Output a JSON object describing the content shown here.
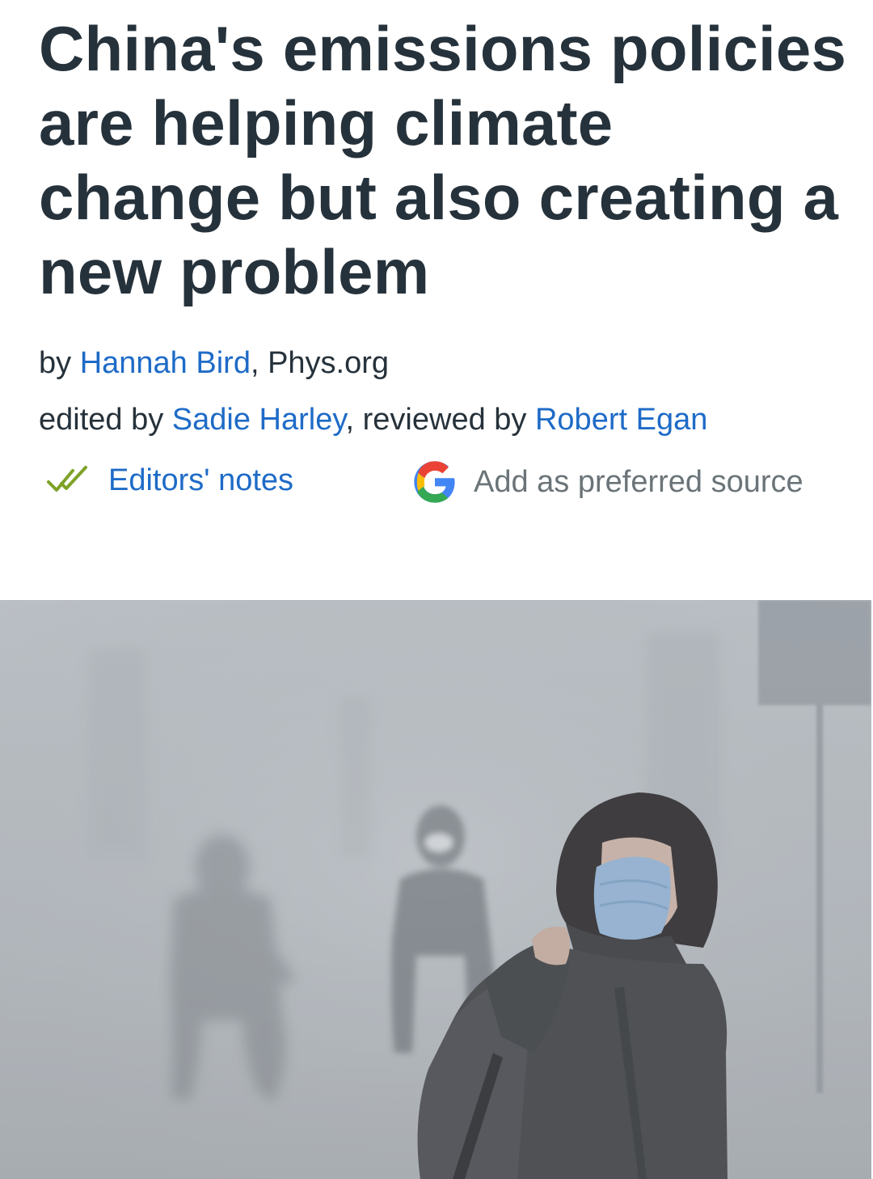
{
  "article": {
    "headline": "China's emissions policies are helping climate change but also creating a new problem",
    "byline": {
      "prefix": "by ",
      "author": "Hannah Bird",
      "separator": ", ",
      "publisher": "Phys.org"
    },
    "credits": {
      "edited_prefix": "edited by ",
      "editor": "Sadie Harley",
      "reviewed_prefix": ", reviewed by ",
      "reviewer": "Robert Egan"
    },
    "editors_notes": {
      "label": "Editors' notes",
      "icon": "double-check-icon"
    },
    "preferred_source": {
      "label": "Add as preferred source",
      "icon": "google-g-icon"
    },
    "image": {
      "alt": "Woman wearing a face mask walking through dense smog"
    }
  },
  "colors": {
    "headline": "#26323b",
    "link": "#1e6bc7",
    "muted": "#6b7478",
    "check": "#7ea226"
  }
}
